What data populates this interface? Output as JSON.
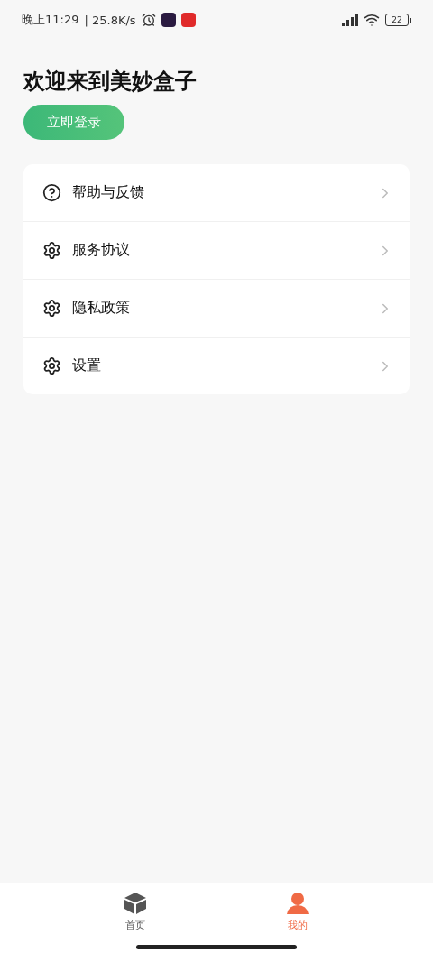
{
  "status_bar": {
    "time": "晚上11:29",
    "speed": "| 25.8K/s",
    "battery": "22"
  },
  "welcome": {
    "title": "欢迎来到美妙盒子",
    "login_button": "立即登录"
  },
  "menu": [
    {
      "kind": "help",
      "label": "帮助与反馈"
    },
    {
      "kind": "settings",
      "label": "服务协议"
    },
    {
      "kind": "settings",
      "label": "隐私政策"
    },
    {
      "kind": "settings",
      "label": "设置"
    }
  ],
  "tab_bar": [
    {
      "kind": "home",
      "label": "首页",
      "selected": false
    },
    {
      "kind": "me",
      "label": "我的",
      "selected": true
    }
  ]
}
